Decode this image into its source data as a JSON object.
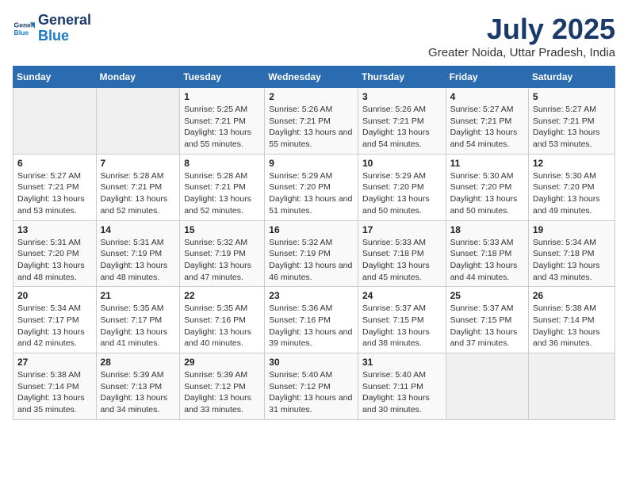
{
  "header": {
    "logo_line1": "General",
    "logo_line2": "Blue",
    "month_year": "July 2025",
    "location": "Greater Noida, Uttar Pradesh, India"
  },
  "days_of_week": [
    "Sunday",
    "Monday",
    "Tuesday",
    "Wednesday",
    "Thursday",
    "Friday",
    "Saturday"
  ],
  "weeks": [
    [
      {
        "num": "",
        "info": ""
      },
      {
        "num": "",
        "info": ""
      },
      {
        "num": "1",
        "info": "Sunrise: 5:25 AM\nSunset: 7:21 PM\nDaylight: 13 hours and 55 minutes."
      },
      {
        "num": "2",
        "info": "Sunrise: 5:26 AM\nSunset: 7:21 PM\nDaylight: 13 hours and 55 minutes."
      },
      {
        "num": "3",
        "info": "Sunrise: 5:26 AM\nSunset: 7:21 PM\nDaylight: 13 hours and 54 minutes."
      },
      {
        "num": "4",
        "info": "Sunrise: 5:27 AM\nSunset: 7:21 PM\nDaylight: 13 hours and 54 minutes."
      },
      {
        "num": "5",
        "info": "Sunrise: 5:27 AM\nSunset: 7:21 PM\nDaylight: 13 hours and 53 minutes."
      }
    ],
    [
      {
        "num": "6",
        "info": "Sunrise: 5:27 AM\nSunset: 7:21 PM\nDaylight: 13 hours and 53 minutes."
      },
      {
        "num": "7",
        "info": "Sunrise: 5:28 AM\nSunset: 7:21 PM\nDaylight: 13 hours and 52 minutes."
      },
      {
        "num": "8",
        "info": "Sunrise: 5:28 AM\nSunset: 7:21 PM\nDaylight: 13 hours and 52 minutes."
      },
      {
        "num": "9",
        "info": "Sunrise: 5:29 AM\nSunset: 7:20 PM\nDaylight: 13 hours and 51 minutes."
      },
      {
        "num": "10",
        "info": "Sunrise: 5:29 AM\nSunset: 7:20 PM\nDaylight: 13 hours and 50 minutes."
      },
      {
        "num": "11",
        "info": "Sunrise: 5:30 AM\nSunset: 7:20 PM\nDaylight: 13 hours and 50 minutes."
      },
      {
        "num": "12",
        "info": "Sunrise: 5:30 AM\nSunset: 7:20 PM\nDaylight: 13 hours and 49 minutes."
      }
    ],
    [
      {
        "num": "13",
        "info": "Sunrise: 5:31 AM\nSunset: 7:20 PM\nDaylight: 13 hours and 48 minutes."
      },
      {
        "num": "14",
        "info": "Sunrise: 5:31 AM\nSunset: 7:19 PM\nDaylight: 13 hours and 48 minutes."
      },
      {
        "num": "15",
        "info": "Sunrise: 5:32 AM\nSunset: 7:19 PM\nDaylight: 13 hours and 47 minutes."
      },
      {
        "num": "16",
        "info": "Sunrise: 5:32 AM\nSunset: 7:19 PM\nDaylight: 13 hours and 46 minutes."
      },
      {
        "num": "17",
        "info": "Sunrise: 5:33 AM\nSunset: 7:18 PM\nDaylight: 13 hours and 45 minutes."
      },
      {
        "num": "18",
        "info": "Sunrise: 5:33 AM\nSunset: 7:18 PM\nDaylight: 13 hours and 44 minutes."
      },
      {
        "num": "19",
        "info": "Sunrise: 5:34 AM\nSunset: 7:18 PM\nDaylight: 13 hours and 43 minutes."
      }
    ],
    [
      {
        "num": "20",
        "info": "Sunrise: 5:34 AM\nSunset: 7:17 PM\nDaylight: 13 hours and 42 minutes."
      },
      {
        "num": "21",
        "info": "Sunrise: 5:35 AM\nSunset: 7:17 PM\nDaylight: 13 hours and 41 minutes."
      },
      {
        "num": "22",
        "info": "Sunrise: 5:35 AM\nSunset: 7:16 PM\nDaylight: 13 hours and 40 minutes."
      },
      {
        "num": "23",
        "info": "Sunrise: 5:36 AM\nSunset: 7:16 PM\nDaylight: 13 hours and 39 minutes."
      },
      {
        "num": "24",
        "info": "Sunrise: 5:37 AM\nSunset: 7:15 PM\nDaylight: 13 hours and 38 minutes."
      },
      {
        "num": "25",
        "info": "Sunrise: 5:37 AM\nSunset: 7:15 PM\nDaylight: 13 hours and 37 minutes."
      },
      {
        "num": "26",
        "info": "Sunrise: 5:38 AM\nSunset: 7:14 PM\nDaylight: 13 hours and 36 minutes."
      }
    ],
    [
      {
        "num": "27",
        "info": "Sunrise: 5:38 AM\nSunset: 7:14 PM\nDaylight: 13 hours and 35 minutes."
      },
      {
        "num": "28",
        "info": "Sunrise: 5:39 AM\nSunset: 7:13 PM\nDaylight: 13 hours and 34 minutes."
      },
      {
        "num": "29",
        "info": "Sunrise: 5:39 AM\nSunset: 7:12 PM\nDaylight: 13 hours and 33 minutes."
      },
      {
        "num": "30",
        "info": "Sunrise: 5:40 AM\nSunset: 7:12 PM\nDaylight: 13 hours and 31 minutes."
      },
      {
        "num": "31",
        "info": "Sunrise: 5:40 AM\nSunset: 7:11 PM\nDaylight: 13 hours and 30 minutes."
      },
      {
        "num": "",
        "info": ""
      },
      {
        "num": "",
        "info": ""
      }
    ]
  ]
}
